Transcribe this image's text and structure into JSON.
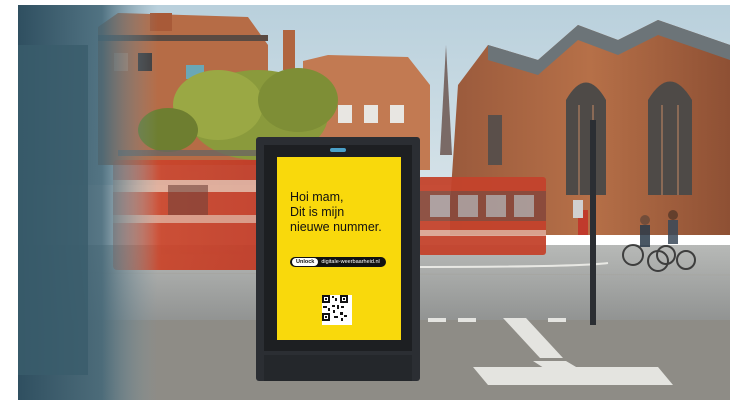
{
  "poster": {
    "headline_lines": [
      "Hoi mam,",
      "Dit is mijn",
      "nieuwe nummer."
    ],
    "button_label": "Unlock",
    "url": "digitale-weerbaarheid.nl"
  },
  "colors": {
    "poster_yellow": "#f9d90c",
    "sky": "#a9c4d2",
    "brick": "#b0653f",
    "tram_red": "#c8452b",
    "kiosk_frame": "#2b2e33"
  },
  "icons": [
    "qr-code-icon"
  ]
}
